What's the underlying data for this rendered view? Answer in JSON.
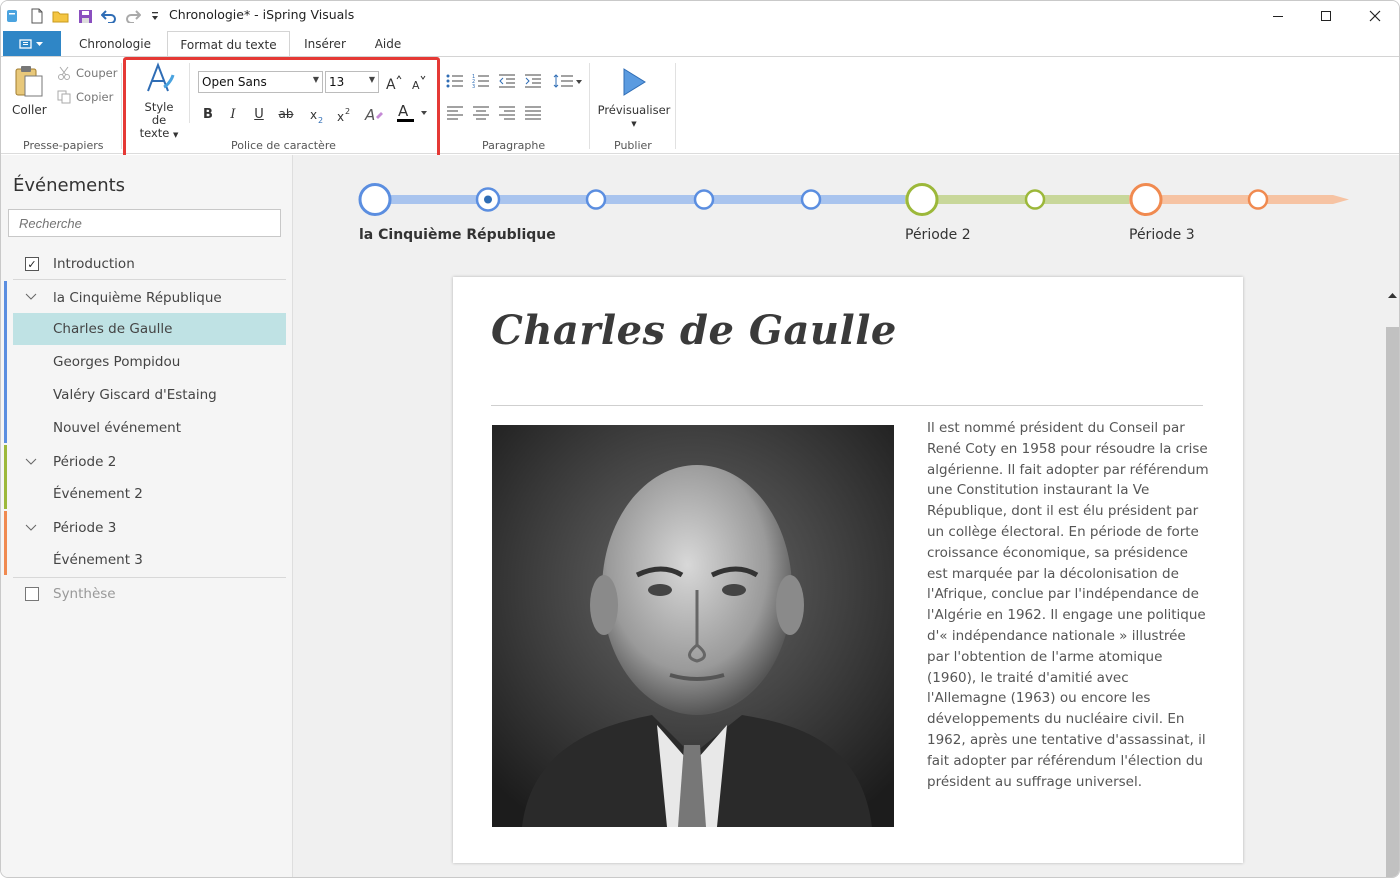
{
  "window": {
    "title": "Chronologie* - iSpring Visuals",
    "minimize_icon": "minimize-icon",
    "maximize_icon": "maximize-icon",
    "close_icon": "close-icon"
  },
  "ribbon_tabs": [
    "Chronologie",
    "Format du texte",
    "Insérer",
    "Aide"
  ],
  "active_tab": "Format du texte",
  "clipboard": {
    "paste": "Coller",
    "cut": "Couper",
    "copy": "Copier",
    "group_label": "Presse-papiers"
  },
  "font_group": {
    "style_label_1": "Style de",
    "style_label_2": "texte",
    "font_name": "Open Sans",
    "font_size": "13",
    "bold": "B",
    "italic": "I",
    "underline": "U",
    "strike": "ab",
    "group_label": "Police de caractère",
    "font_color": "#000000"
  },
  "paragraph_group": {
    "group_label": "Paragraphe"
  },
  "publish_group": {
    "preview": "Prévisualiser",
    "group_label": "Publier"
  },
  "sidebar": {
    "title": "Événements",
    "search_placeholder": "Recherche",
    "items": [
      {
        "label": "Introduction",
        "type": "check",
        "checked": true
      },
      {
        "label": "la Cinquième République",
        "type": "group"
      },
      {
        "label": "Charles de Gaulle",
        "type": "child",
        "selected": true
      },
      {
        "label": "Georges Pompidou",
        "type": "child"
      },
      {
        "label": "Valéry Giscard d'Estaing",
        "type": "child"
      },
      {
        "label": "Nouvel événement",
        "type": "child"
      },
      {
        "label": "Période 2",
        "type": "group"
      },
      {
        "label": "Événement 2",
        "type": "child"
      },
      {
        "label": "Période 3",
        "type": "group"
      },
      {
        "label": "Événement 3",
        "type": "child"
      },
      {
        "label": "Synthèse",
        "type": "check",
        "checked": false
      }
    ]
  },
  "timeline": {
    "labels": [
      "la Cinquième République",
      "Période 2",
      "Période 3"
    ],
    "colors": {
      "period1": "#5b8ee0",
      "period1_line": "#a9c4ee",
      "period2": "#9cb83a",
      "period2_line": "#c8d79a",
      "period3": "#f08a50",
      "period3_line": "#f6c3a3"
    }
  },
  "card": {
    "title": "Charles de Gaulle",
    "body": "Il est nommé président du Conseil par René Coty en 1958 pour résoudre la crise algérienne. Il fait adopter par référendum une Constitution instaurant la Ve République, dont il est élu président par un collège électoral. En période de forte croissance économique, sa présidence est marquée par la décolonisation de l'Afrique, conclue par l'indépendance de l'Algérie en 1962. Il engage une politique d'« indépendance nationale » illustrée par l'obtention de l'arme atomique (1960), le traité d'amitié avec l'Allemagne (1963) ou encore les développements du nucléaire civil. En 1962, après une tentative d'assassinat, il fait adopter par référendum l'élection du président au suffrage universel."
  }
}
